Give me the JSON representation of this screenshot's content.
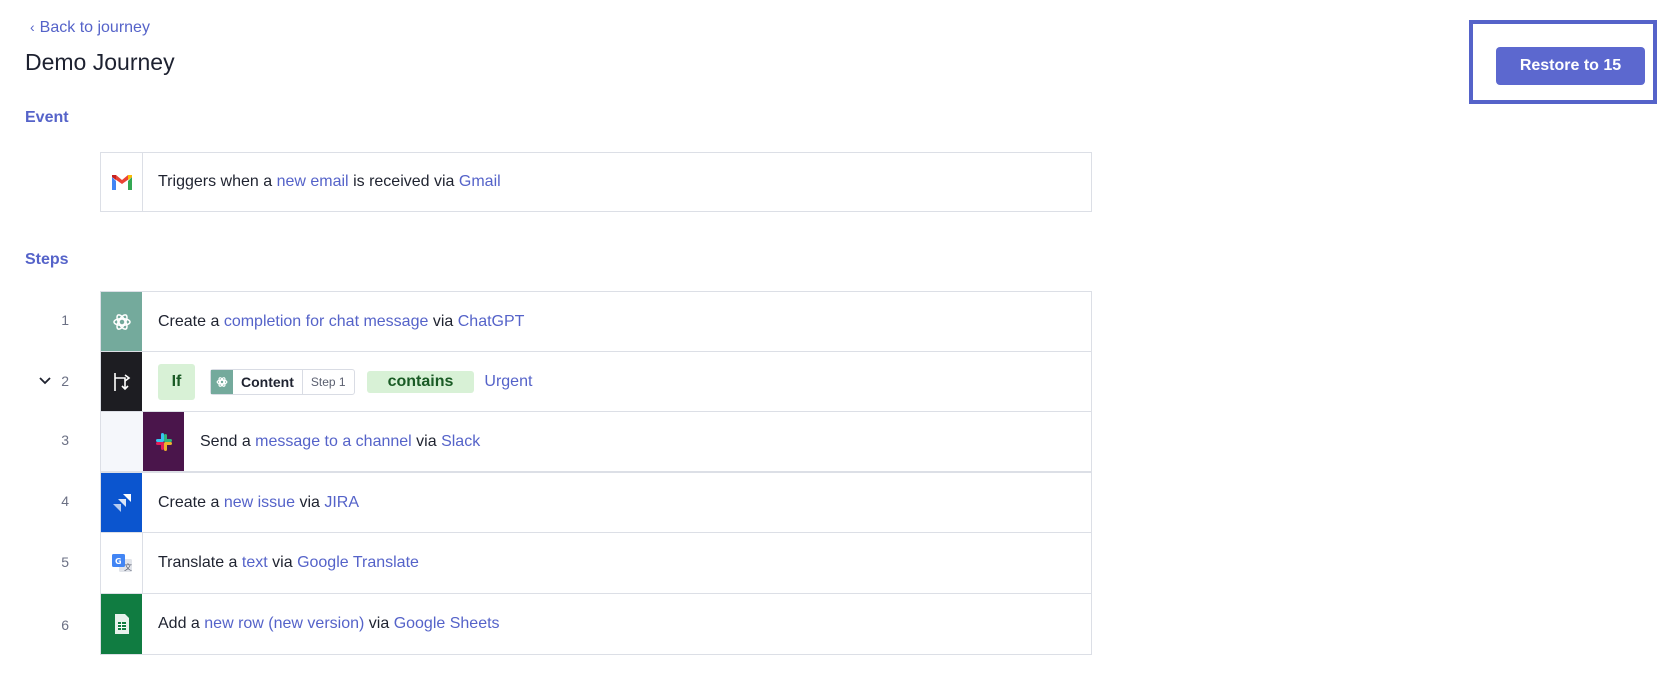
{
  "header": {
    "back_label": "Back to journey",
    "title": "Demo Journey",
    "restore_label": "Restore to 15"
  },
  "event": {
    "section_label": "Event",
    "trigger": {
      "prefix": "Triggers when a",
      "object": "new email",
      "middle": "is received via",
      "app": "Gmail",
      "icon": "gmail-icon"
    }
  },
  "steps": {
    "section_label": "Steps",
    "items": [
      {
        "number": "1",
        "prefix": "Create a",
        "object": "completion for chat message",
        "via": "via",
        "app": "ChatGPT",
        "icon": "chatgpt-icon",
        "icon_bg": "#74aa9c"
      },
      {
        "number": "2",
        "condition": {
          "keyword": "If",
          "field": "Content",
          "field_step": "Step 1",
          "operator": "contains",
          "value": "Urgent"
        },
        "icon": "branch-icon",
        "icon_bg": "#1d1d22"
      },
      {
        "number": "3",
        "prefix": "Send a",
        "object": "message to a channel",
        "via": "via",
        "app": "Slack",
        "icon": "slack-icon",
        "icon_bg": "#4a154b"
      },
      {
        "number": "4",
        "prefix": "Create a",
        "object": "new issue",
        "via": "via",
        "app": "JIRA",
        "icon": "jira-icon",
        "icon_bg": "#0b55cf"
      },
      {
        "number": "5",
        "prefix": "Translate a",
        "object": "text",
        "via": "via",
        "app": "Google Translate",
        "icon": "google-translate-icon",
        "icon_bg": "#ffffff"
      },
      {
        "number": "6",
        "prefix": "Add a",
        "object": "new row (new version)",
        "via": "via",
        "app": "Google Sheets",
        "icon": "google-sheets-icon",
        "icon_bg": "#107c41"
      }
    ]
  },
  "colors": {
    "accent": "#5563c9",
    "button": "#5c68cf",
    "condition_bg": "#d8f1d6",
    "condition_text": "#1a5b25",
    "border": "#dcdfe6"
  }
}
